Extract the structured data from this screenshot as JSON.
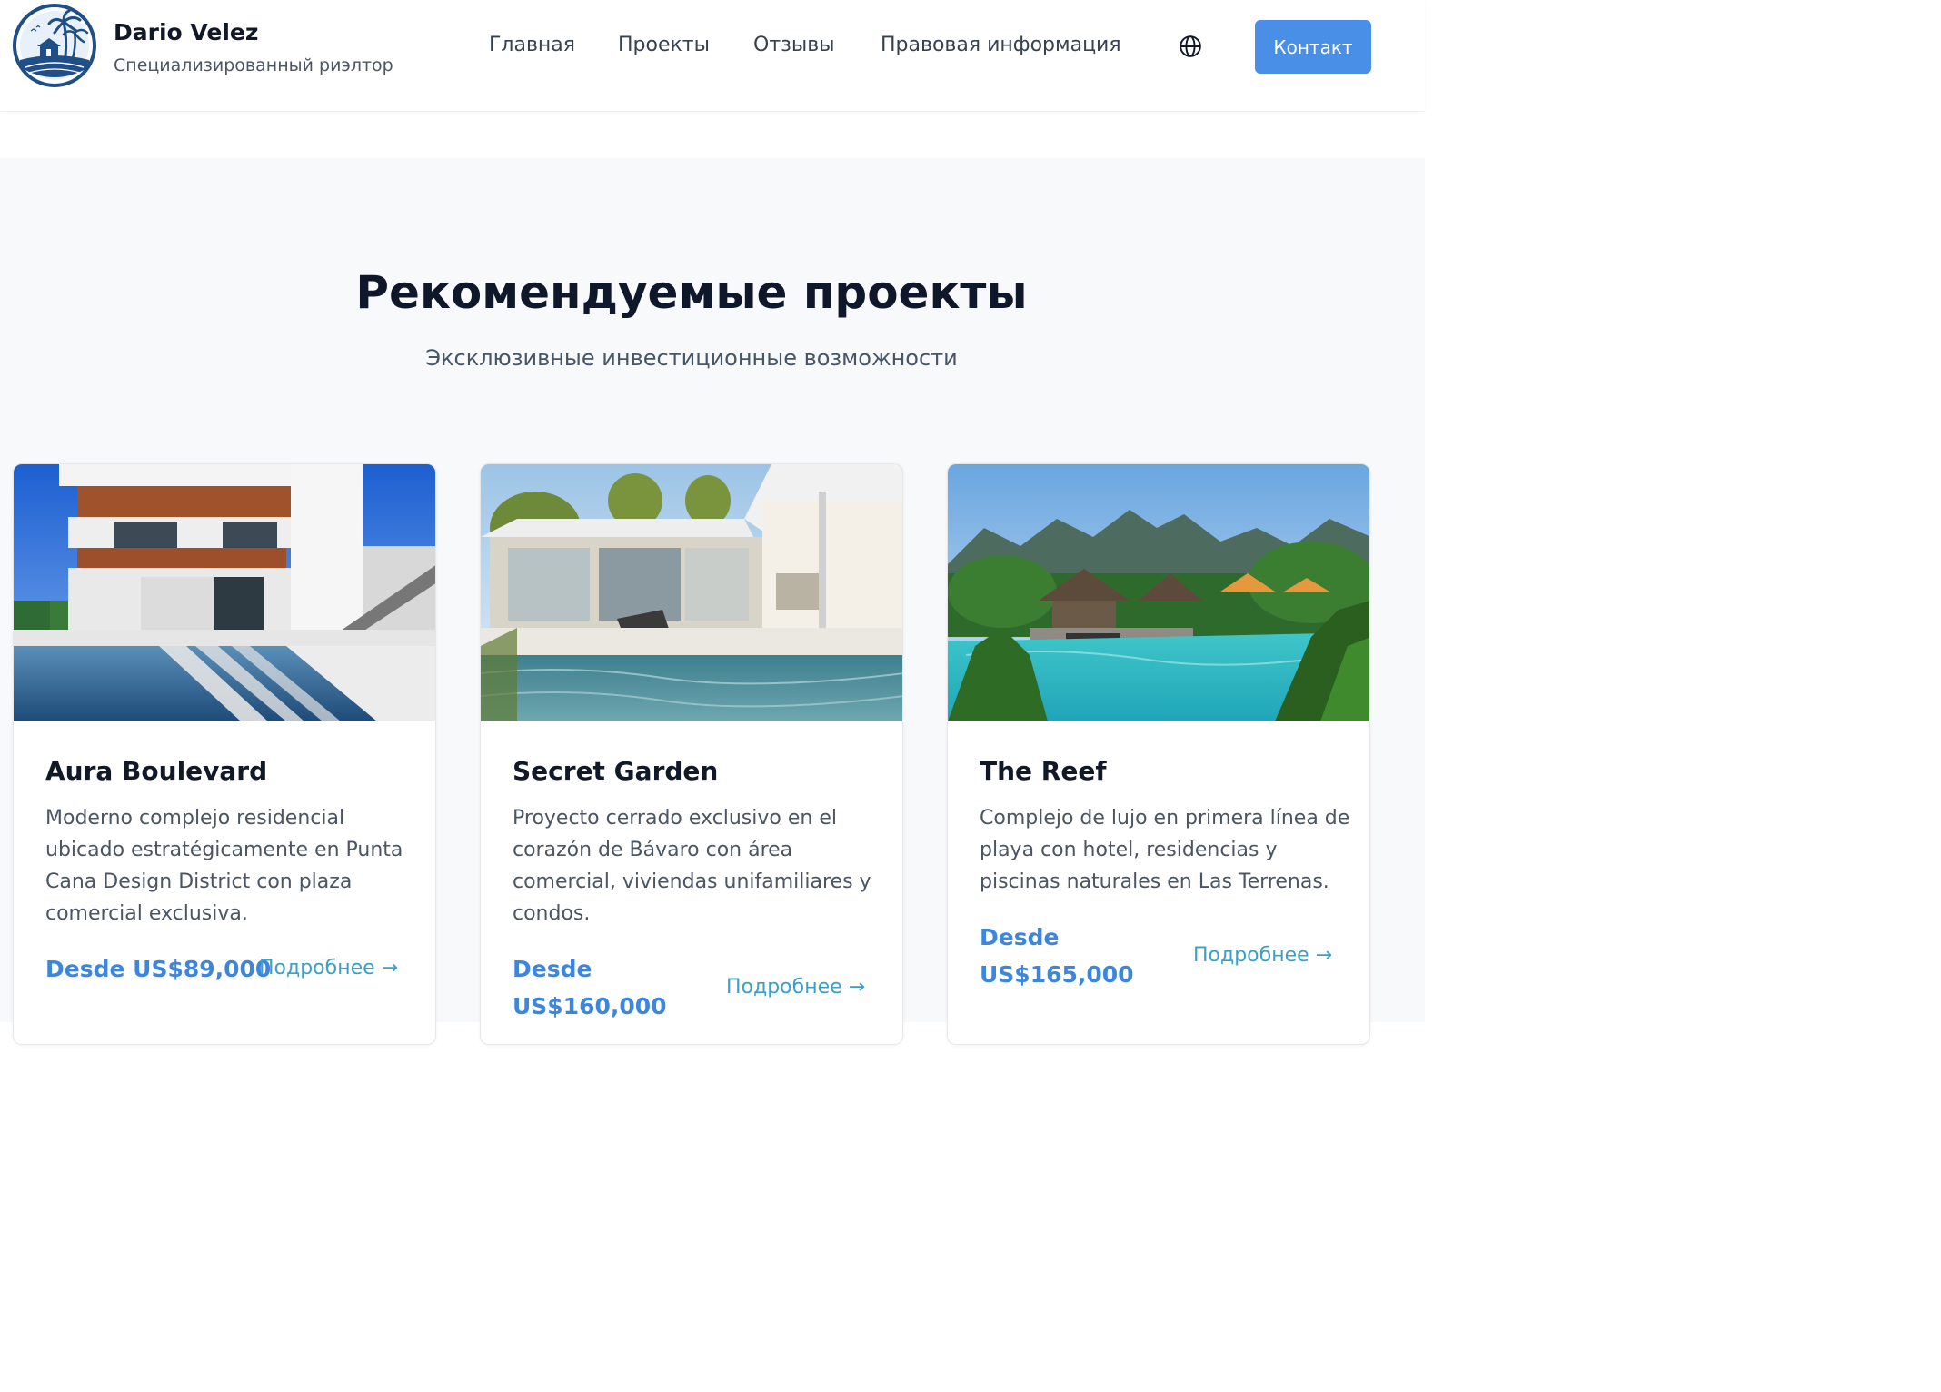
{
  "header": {
    "brand_name": "Dario Velez",
    "brand_subtitle": "Специализированный риэлтор",
    "nav": [
      {
        "label": "Главная"
      },
      {
        "label": "Проекты"
      },
      {
        "label": "Отзывы"
      },
      {
        "label": "Правовая информация"
      }
    ],
    "language_icon": "globe-icon",
    "contact_label": "Контакт"
  },
  "colors": {
    "accent": "#4a8fe7",
    "price": "#3d86db",
    "link": "#3aa0c8",
    "logo": "#1f4f86"
  },
  "projects": {
    "title": "Рекомендуемые проекты",
    "subtitle": "Эксклюзивные инвестиционные возможности",
    "cards": [
      {
        "name": "Aura Boulevard",
        "description": "Moderno complejo residencial ubicado estratégicamente en Punta Cana Design District con plaza comercial exclusiva.",
        "price": "Desde US$89,000",
        "more_label": "Подробнее →"
      },
      {
        "name": "Secret Garden",
        "description": "Proyecto cerrado exclusivo en el corazón de Bávaro con área comercial, viviendas unifamiliares y condos.",
        "price": "Desde US$160,000",
        "more_label": "Подробнее →"
      },
      {
        "name": "The Reef",
        "description": "Complejo de lujo en primera línea de playa con hotel, residencias y piscinas naturales en Las Terrenas.",
        "price": "Desde US$165,000",
        "more_label": "Подробнее →"
      }
    ]
  }
}
